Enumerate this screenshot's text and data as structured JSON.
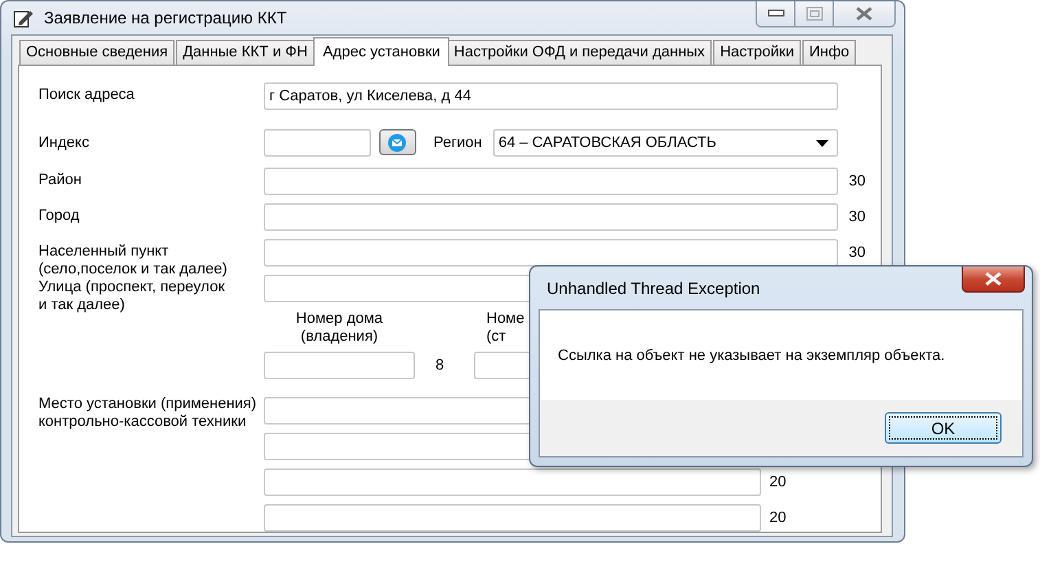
{
  "window": {
    "title": "Заявление на регистрацию ККТ"
  },
  "tabs": [
    {
      "label": "Основные сведения",
      "selected": false
    },
    {
      "label": "Данные ККТ и ФН",
      "selected": false
    },
    {
      "label": "Адрес установки",
      "selected": true
    },
    {
      "label": "Настройки ОФД и передачи данных",
      "selected": false
    },
    {
      "label": "Настройки",
      "selected": false
    },
    {
      "label": "Инфо",
      "selected": false
    }
  ],
  "form": [
    {
      "kind": "text",
      "label": "Поиск адреса",
      "value": "г Саратов, ул Киселева, д 44"
    },
    {
      "kind": "index-region",
      "label": "Индекс",
      "region_label": "Регион",
      "region_value": "64 – САРАТОВСКАЯ ОБЛАСТЬ"
    },
    {
      "kind": "text",
      "label": "Район",
      "limit": "30"
    },
    {
      "kind": "text",
      "label": "Город",
      "limit": "30"
    },
    {
      "kind": "text",
      "label": "Населенный пункт\n(село,поселок и так далее)",
      "limit": "30"
    },
    {
      "kind": "text",
      "label": "Улица (проспект, переулок\nи так далее)"
    },
    {
      "kind": "house",
      "columns": [
        {
          "label": "Номер дома\n(владения)",
          "limit": "8"
        },
        {
          "label": "Номе\n(ст"
        }
      ]
    },
    {
      "kind": "multi",
      "label": "Место установки (применения)\nконтрольно-кассовой техники",
      "lines": [
        {
          "kind": "field"
        },
        {
          "kind": "field"
        },
        {
          "kind": "field",
          "limit": "20"
        },
        {
          "kind": "field",
          "limit": "20"
        }
      ]
    }
  ],
  "dialog": {
    "title": "Unhandled Thread Exception",
    "message": "Ссылка на объект не указывает на экземпляр объекта.",
    "buttons": [
      {
        "label": "OK",
        "default": true
      }
    ]
  }
}
